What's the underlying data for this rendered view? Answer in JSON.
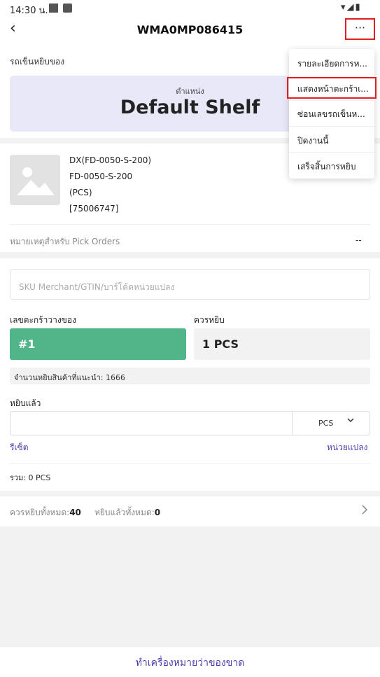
{
  "status_bar": {
    "time": "14:30 น.",
    "right_icons": "▾◢▮"
  },
  "header": {
    "title": "WMA0MP086415",
    "back_icon": "‹",
    "more_icon": "···"
  },
  "cart": {
    "label": "รถเข็นหยิบของ",
    "location_label": "ตำแหน่ง",
    "location_value": "Default Shelf"
  },
  "product": {
    "name_line1": "DX(FD-0050-S-200)",
    "name_line2": "FD-0050-S-200",
    "unit": "(PCS)",
    "code": "[75006747]",
    "note_label": "หมายเหตุสำหรับ Pick Orders",
    "note_value": "--"
  },
  "inputs": {
    "sku_placeholder": "SKU Merchant/GTIN/บาร์โค้ดหน่วยแปลง",
    "basket_label": "เลขตะกร้าวางของ",
    "basket_value": "#1",
    "should_pick_label": "ควรหยิบ",
    "should_pick_value": "1 PCS",
    "suggested_text": "จำนวนหยิบสินค้าที่แนะนำ: 1666",
    "picked_label": "หยิบแล้ว",
    "picked_value": "",
    "unit_value": "PCS",
    "reset_link": "รีเซ็ต",
    "unit_convert_link": "หน่วยแปลง",
    "total_text": "รวม: 0 PCS"
  },
  "summary": {
    "should_pick_total_label": "ควรหยิบทั้งหมด:",
    "should_pick_total_value": "40",
    "picked_total_label": "หยิบแล้วทั้งหมด:",
    "picked_total_value": "0"
  },
  "bottom": {
    "link": "ทำเครื่องหมายว่าของขาด"
  },
  "menu": {
    "items": [
      {
        "label": "รายละเอียดการห..."
      },
      {
        "label": "แสดงหน้าตะกร้าเ..."
      },
      {
        "label": "ซ่อนเลขรถเข็นห..."
      },
      {
        "label": "ปิดงานนี้"
      },
      {
        "label": "เสร็จสิ้นการหยิบ"
      }
    ]
  },
  "colors": {
    "accent": "#4a3fb0",
    "basket_green": "#52b58a",
    "highlight_red": "#e02020"
  }
}
